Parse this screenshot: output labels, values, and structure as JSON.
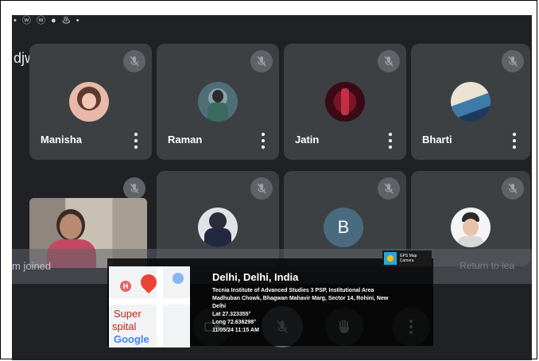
{
  "status_icons": "• ⓦ ⓦ ● ♨ •",
  "meeting": {
    "code": "djwo-ugv",
    "code_chevron": "▸"
  },
  "participants": [
    {
      "name": "Manisha",
      "avatar": "photo"
    },
    {
      "name": "Raman",
      "avatar": "photo"
    },
    {
      "name": "Jatin",
      "avatar": "photo"
    },
    {
      "name": "Bharti",
      "avatar": "photo"
    },
    {
      "name": "",
      "avatar": "self-video"
    },
    {
      "name": "",
      "avatar": "photo"
    },
    {
      "name": "",
      "avatar": "letter",
      "letter": "B"
    },
    {
      "name": "",
      "avatar": "photo"
    }
  ],
  "banner": {
    "joined_text": "m joined",
    "return_text": "Return to lea"
  },
  "controls": [
    "camera-icon",
    "mic-off-icon",
    "raise-hand-icon",
    "more-vert-icon"
  ],
  "gps": {
    "badge": "GPS Map Camera",
    "location": "Delhi, Delhi, India",
    "address_line1": "Tecnia Institute of Advanced Studies 3 PSP, Institutional Area",
    "address_line2": "Madhuban Chowk, Bhagwan Mahavir Marg, Sector 14, Rohini, New",
    "address_line3": "Delhi",
    "lat": "Lat 27.323355°",
    "long": "Long 72.636298°",
    "datetime": "11/05/24 11:15 AM",
    "map_label1": "Super",
    "map_label2": "spital",
    "map_brand": "Google"
  },
  "colors": {
    "tile": "#3c4043",
    "background": "#202124",
    "mute_badge": "#5f6368"
  }
}
